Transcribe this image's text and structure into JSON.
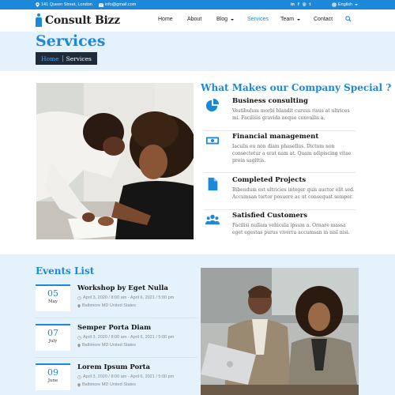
{
  "topbar": {
    "address": "141 Queen Street, London",
    "email": "info@gmail.com",
    "social": [
      "in",
      "f",
      "◎",
      "t"
    ],
    "language": "English"
  },
  "nav": {
    "brand": "Consult Bizz",
    "items": [
      {
        "label": "Home"
      },
      {
        "label": "About"
      },
      {
        "label": "Blog"
      },
      {
        "label": "Services"
      },
      {
        "label": "Team"
      },
      {
        "label": "Contact"
      }
    ]
  },
  "header": {
    "title": "Services",
    "breadcrumb_home": "Home",
    "breadcrumb_current": "Services"
  },
  "services": {
    "title": "What Makes our Company Special ?",
    "features": [
      {
        "icon": "pie-chart-icon",
        "title": "Business consulting",
        "text": "Vestibulum morbi blandit cursus risus at ultrices mi. Facilisis gravida neque convallis a."
      },
      {
        "icon": "money-icon",
        "title": "Financial management",
        "text": "Iaculis eu non diam phasellus. Dictum non consectetur a erat nam at. Quam adipiscing vitae proin sagittis."
      },
      {
        "icon": "document-icon",
        "title": "Completed Projects",
        "text": "Bibendum est ultricies integer quis auctor elit sed. Accumsan tortor posuere ac ut consequat semper."
      },
      {
        "icon": "users-icon",
        "title": "Satisfied Customers",
        "text": "Facilisi nullam vehicula ipsum a. Ornare massa eget egestas purus viverra accumsan in nisl nisi."
      }
    ]
  },
  "events": {
    "title": "Events List",
    "items": [
      {
        "day": "05",
        "month": "May",
        "title": "Workshop by Eget Nulla",
        "time": "April 3, 2020 / 8:00 am - April 6, 2021 / 5:00 pm",
        "location": "Baltimore MD United States"
      },
      {
        "day": "07",
        "month": "July",
        "title": "Semper Porta Diam",
        "time": "April 3, 2020 / 8:00 am - April 6, 2021 / 5:00 pm",
        "location": "Baltimore MD United States"
      },
      {
        "day": "09",
        "month": "June",
        "title": "Lorem Ipsum Porta",
        "time": "April 3, 2020 / 8:00 am - April 6, 2021 / 5:00 pm",
        "location": "Baltimore MD United States"
      }
    ]
  },
  "colors": {
    "accent": "#1e88d8",
    "dark": "#1d2b3a",
    "light_bg": "#e6f2fb"
  }
}
